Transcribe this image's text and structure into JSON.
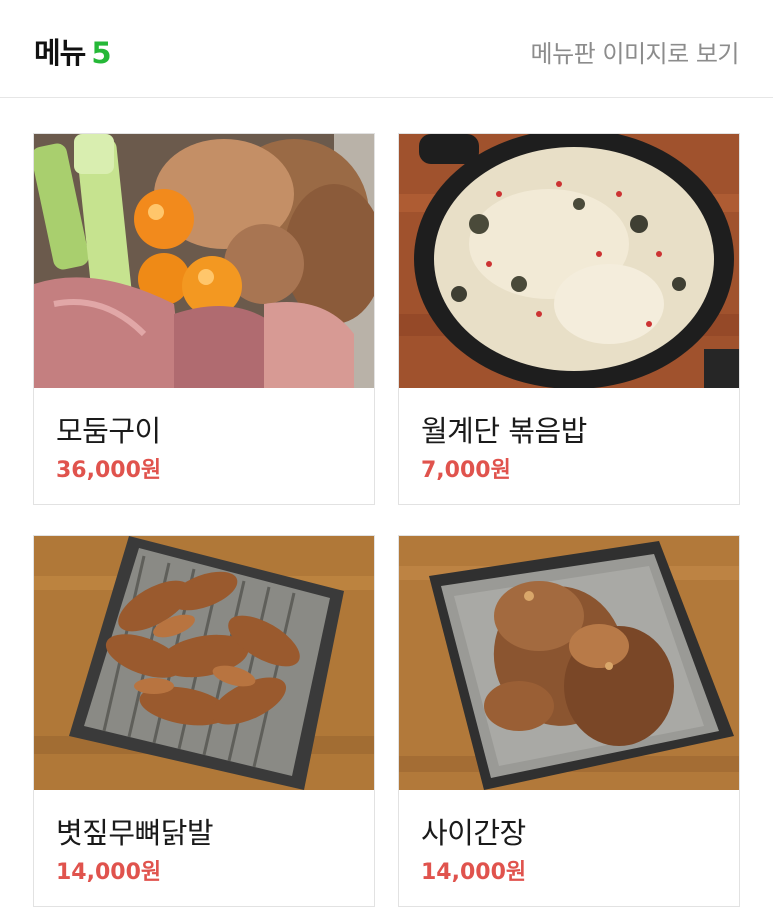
{
  "header": {
    "title": "메뉴",
    "count": "5",
    "view_image_label": "메뉴판 이미지로 보기"
  },
  "menu": [
    {
      "name": "모둠구이",
      "price": "36,000원"
    },
    {
      "name": "월계단 볶음밥",
      "price": "7,000원"
    },
    {
      "name": "볏짚무뼈닭발",
      "price": "14,000원"
    },
    {
      "name": "사이간장",
      "price": "14,000원"
    }
  ],
  "colors": {
    "accent_green": "#25b837",
    "price_red": "#e0534d"
  }
}
